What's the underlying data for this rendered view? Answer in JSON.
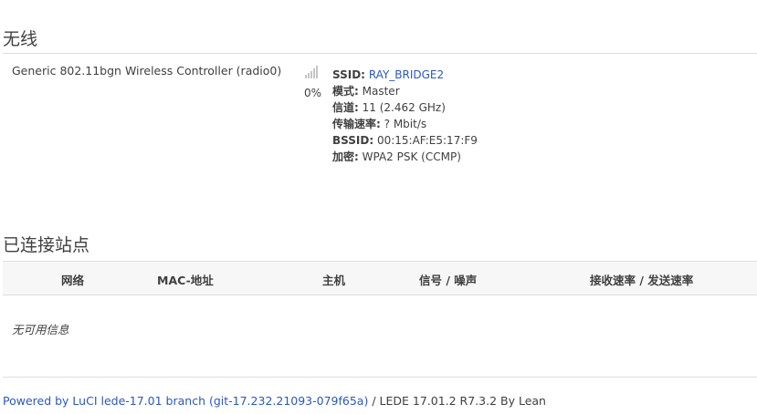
{
  "wireless": {
    "title": "无线",
    "device_name": "Generic 802.11bgn Wireless Controller (radio0)",
    "signal_percent": "0%",
    "signal_icon": "signal-bars-icon",
    "info": {
      "ssid_label": "SSID:",
      "ssid_value": "RAY_BRIDGE2",
      "mode_label": "模式:",
      "mode_value": "Master",
      "channel_label": "信道:",
      "channel_value": "11 (2.462 GHz)",
      "rate_label": "传输速率:",
      "rate_value": "? Mbit/s",
      "bssid_label": "BSSID:",
      "bssid_value": "00:15:AF:E5:17:F9",
      "encryption_label": "加密:",
      "encryption_value": "WPA2 PSK (CCMP)"
    }
  },
  "stations": {
    "title": "已连接站点",
    "columns": [
      "网络",
      "MAC-地址",
      "主机",
      "信号 / 噪声",
      "接收速率 / 发送速率"
    ],
    "empty_message": "无可用信息"
  },
  "footer": {
    "link_text": "Powered by LuCI lede-17.01 branch (git-17.232.21093-079f65a)",
    "suffix_text": " / LEDE 17.01.2 R7.3.2 By Lean"
  },
  "colors": {
    "link": "#2a57c4",
    "text": "#404040",
    "rule": "#dddddd"
  }
}
